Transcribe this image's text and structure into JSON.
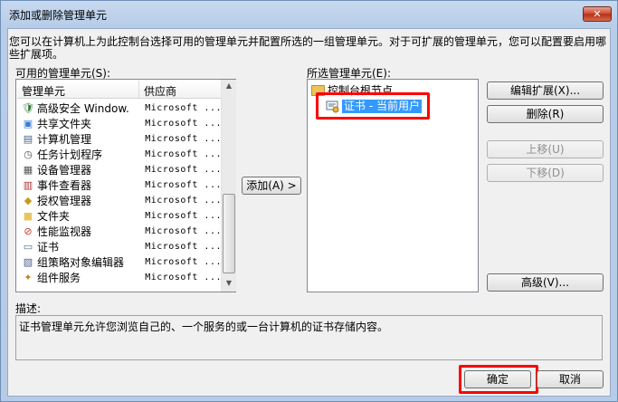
{
  "window": {
    "title": "添加或删除管理单元",
    "close_label": "✕"
  },
  "intro_text": "您可以在计算机上为此控制台选择可用的管理单元并配置所选的一组管理单元。对于可扩展的管理单元，您可以配置要启用哪些扩展项。",
  "available": {
    "label": "可用的管理单元(S):",
    "columns": [
      "管理单元",
      "供应商"
    ],
    "rows": [
      {
        "name": "高级安全 Window...",
        "vendor": "Microsoft ...",
        "icon": "firewall-icon"
      },
      {
        "name": "共享文件夹",
        "vendor": "Microsoft ...",
        "icon": "shared-folder-icon"
      },
      {
        "name": "计算机管理",
        "vendor": "Microsoft ...",
        "icon": "computer-management-icon"
      },
      {
        "name": "任务计划程序",
        "vendor": "Microsoft ...",
        "icon": "task-scheduler-icon"
      },
      {
        "name": "设备管理器",
        "vendor": "Microsoft ...",
        "icon": "device-manager-icon"
      },
      {
        "name": "事件查看器",
        "vendor": "Microsoft ...",
        "icon": "event-viewer-icon"
      },
      {
        "name": "授权管理器",
        "vendor": "Microsoft ...",
        "icon": "authorization-manager-icon"
      },
      {
        "name": "文件夹",
        "vendor": "Microsoft ...",
        "icon": "folder-icon"
      },
      {
        "name": "性能监视器",
        "vendor": "Microsoft ...",
        "icon": "performance-monitor-icon"
      },
      {
        "name": "证书",
        "vendor": "Microsoft ...",
        "icon": "certificate-icon"
      },
      {
        "name": "组策略对象编辑器",
        "vendor": "Microsoft ...",
        "icon": "group-policy-icon"
      },
      {
        "name": "组件服务",
        "vendor": "Microsoft ...",
        "icon": "component-services-icon"
      }
    ]
  },
  "add_button": "添加(A) >",
  "selected": {
    "label": "所选管理单元(E):",
    "root": "控制台根节点",
    "child": "证书 - 当前用户"
  },
  "side_buttons": {
    "edit_extensions": "编辑扩展(X)...",
    "remove": "删除(R)",
    "move_up": "上移(U)",
    "move_down": "下移(D)",
    "advanced": "高级(V)..."
  },
  "description": {
    "label": "描述:",
    "text": "证书管理单元允许您浏览自己的、一个服务的或一台计算机的证书存储内容。"
  },
  "footer": {
    "ok": "确定",
    "cancel": "取消"
  },
  "colors": {
    "highlight": "#3399ff",
    "annotation": "#ff0000"
  }
}
